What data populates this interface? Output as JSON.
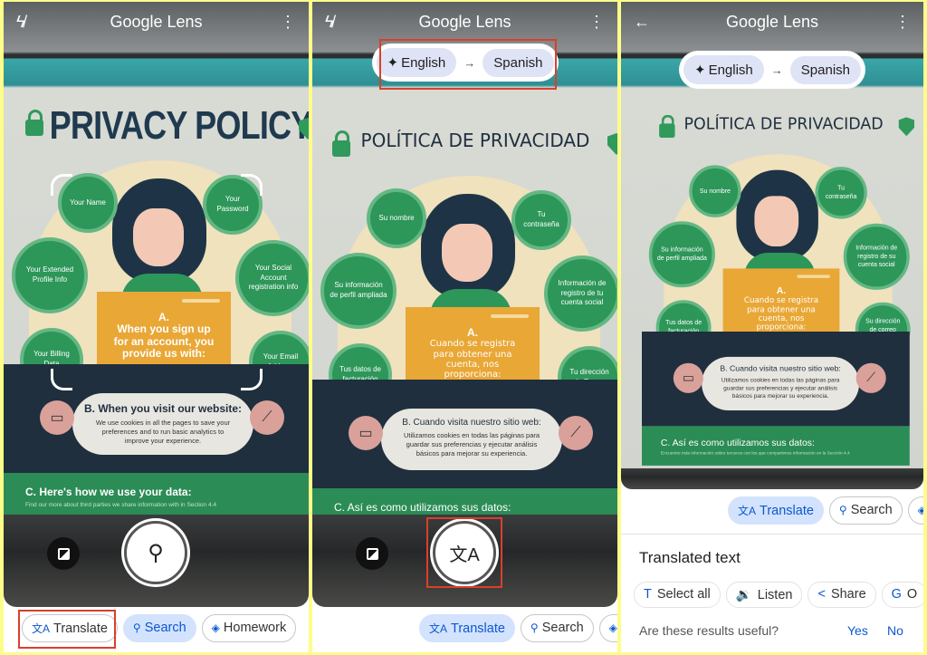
{
  "app_title": "Google Lens",
  "colors": {
    "accent": "#0b57d0",
    "chip_selected": "#d3e3fd",
    "highlight_box": "#d9402b",
    "poster_green": "#2d9659",
    "poster_orange": "#e9a736",
    "frame": "#fdfd8a"
  },
  "panels": [
    {
      "header": {
        "title": "Google Lens",
        "left_icon": "flash-off-icon",
        "right_icon": "more-vert-icon"
      },
      "poster": {
        "title": "PRIVACY POLICY",
        "circles": [
          "Your Name",
          "Your Password",
          "Your Extended Profile Info",
          "Your Social Account registration info",
          "Your Billing Data",
          "Your Email Address"
        ],
        "a_label": "A.",
        "a_text": "When you sign up for an account, you provide us with:",
        "b_title": "B. When you visit our website:",
        "b_text": "We use cookies in all the pages to save your preferences and to run basic analytics to improve your experience.",
        "c_title": "C. Here's how we use your data:",
        "c_text": "Find our more about third parties we share information with in Section 4.4"
      },
      "shutter_icon": "search-icon",
      "chips": [
        {
          "label": "Translate",
          "icon": "translate-icon",
          "selected": false
        },
        {
          "label": "Search",
          "icon": "search-icon",
          "selected": true
        },
        {
          "label": "Homework",
          "icon": "homework-icon",
          "selected": false
        }
      ]
    },
    {
      "header": {
        "title": "Google Lens",
        "left_icon": "flash-off-icon",
        "right_icon": "more-vert-icon"
      },
      "lang": {
        "from": "English",
        "arrow": "→",
        "to": "Spanish"
      },
      "poster": {
        "title": "POLÍTICA DE PRIVACIDAD",
        "circles": [
          "Su nombre",
          "Tu contraseña",
          "Su información de perfil ampliada",
          "Información de registro de tu cuenta social",
          "Tus datos de facturación",
          "Tu dirección de Emma"
        ],
        "a_label": "A.",
        "a_text": "Cuando se registra para obtener una cuenta, nos proporciona:",
        "b_title": "B. Cuando visita nuestro sitio web:",
        "b_text": "Utilizamos cookies en todas las páginas para guardar sus preferencias y ejecutar análisis básicos para mejorar su experiencia.",
        "c_title": "C. Así es como utilizamos sus datos:",
        "c_text": "Encuentre más información sobre terceros con los que compartimos información en la Sección 4.4"
      },
      "shutter_icon": "translate-icon",
      "chips": [
        {
          "label": "Translate",
          "icon": "translate-icon",
          "selected": true
        },
        {
          "label": "Search",
          "icon": "search-icon",
          "selected": false
        },
        {
          "label": "",
          "icon": "homework-icon",
          "selected": false
        }
      ]
    },
    {
      "header": {
        "title": "Google Lens",
        "left_icon": "back-arrow-icon",
        "right_icon": "more-vert-icon"
      },
      "lang": {
        "from": "English",
        "arrow": "→",
        "to": "Spanish"
      },
      "poster": {
        "title": "POLÍTICA DE PRIVACIDAD",
        "circles": [
          "Su nombre",
          "Tu contraseña",
          "Su información de perfil ampliada",
          "Información de registro de su cuenta social",
          "Tus datos de facturación",
          "Su dirección de correo electrónico"
        ],
        "a_label": "A.",
        "a_text": "Cuando se registra para obtener una cuenta, nos proporciona:",
        "b_title": "B. Cuando visita nuestro sitio web:",
        "b_text": "Utilizamos cookies en todas las páginas para guardar sus preferencias y ejecutar análisis básicos para mejorar su experiencia.",
        "c_title": "C. Así es como utilizamos sus datos:",
        "c_text": "Encuentre más información sobre terceros con los que compartimos información en la Sección 4.4"
      },
      "chips": [
        {
          "label": "Translate",
          "icon": "translate-icon",
          "selected": true
        },
        {
          "label": "Search",
          "icon": "search-icon",
          "selected": false
        },
        {
          "label": "",
          "icon": "homework-icon",
          "selected": false
        }
      ],
      "sheet": {
        "title": "Translated text",
        "actions": [
          {
            "label": "Select all",
            "icon": "text-select-icon"
          },
          {
            "label": "Listen",
            "icon": "speaker-icon"
          },
          {
            "label": "Share",
            "icon": "share-icon"
          },
          {
            "label": "O",
            "icon": "google-translate-icon"
          }
        ],
        "feedback_question": "Are these results useful?",
        "yes": "Yes",
        "no": "No"
      }
    }
  ]
}
